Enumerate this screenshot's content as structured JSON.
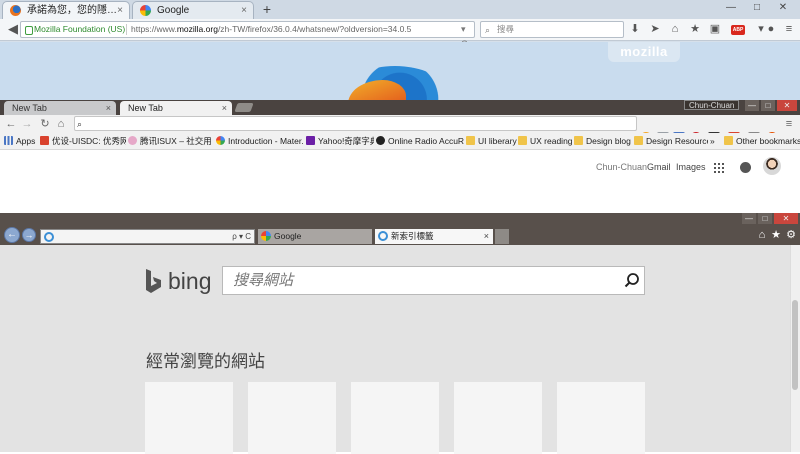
{
  "firefox": {
    "tabs": [
      {
        "label": "承諾為您，您的隱私權與 ...",
        "close": "×"
      },
      {
        "label": "Google",
        "close": "×"
      }
    ],
    "new_tab": "+",
    "identity": "Mozilla Foundation (US)",
    "url_prefix": "https://www.",
    "url_domain": "mozilla.org",
    "url_rest": "/zh-TW/firefox/36.0.4/whatsnew/?oldversion=34.0.5",
    "search_placeholder": "搜尋",
    "abp_label": "ABP",
    "brand_tab": "mozilla",
    "window_buttons": [
      "—",
      "□",
      "✕"
    ]
  },
  "chrome": {
    "tabs": [
      {
        "label": "New Tab",
        "close": "×"
      },
      {
        "label": "New Tab",
        "close": "×"
      }
    ],
    "profile": "Chun-Chuan",
    "bookmarks": [
      {
        "label": "Apps",
        "icon": "apps-icon",
        "color": "#4a76c4"
      },
      {
        "label": "优设-UISDC: 优秀网页...",
        "icon": "uisdc-icon",
        "color": "#d9422e"
      },
      {
        "label": "腾讯ISUX – 社交用户...",
        "icon": "isux-icon",
        "color": "#e6a8c8"
      },
      {
        "label": "Introduction - Mater...",
        "icon": "google-icon",
        "color": "#ffffff"
      },
      {
        "label": "Yahoo!奇摩字典",
        "icon": "yahoo-icon",
        "color": "#6b1fa6"
      },
      {
        "label": "Online Radio AccuRa...",
        "icon": "radio-icon",
        "color": "#222222"
      },
      {
        "label": "UI liberary",
        "icon": "folder-icon",
        "color": "#f0c44a"
      },
      {
        "label": "UX reading",
        "icon": "folder-icon",
        "color": "#f0c44a"
      },
      {
        "label": "Design blog",
        "icon": "folder-icon",
        "color": "#f0c44a"
      },
      {
        "label": "Design Resource",
        "icon": "folder-icon",
        "color": "#f0c44a"
      },
      {
        "label": "Other bookmarks",
        "icon": "folder-icon",
        "color": "#f0c44a"
      }
    ],
    "overflow": "»",
    "user_links": {
      "name": "Chun-Chuan",
      "gmail": "Gmail",
      "images": "Images"
    }
  },
  "ie": {
    "tabs": [
      {
        "label": "Google",
        "close": ""
      },
      {
        "label": "新索引標籤",
        "close": "×"
      }
    ],
    "address_controls": "ρ ▾ C",
    "bing_logo": "bing",
    "search_placeholder": "搜尋網站",
    "frequent_title": "經常瀏覽的網站",
    "accent": "#3b8fd6"
  }
}
